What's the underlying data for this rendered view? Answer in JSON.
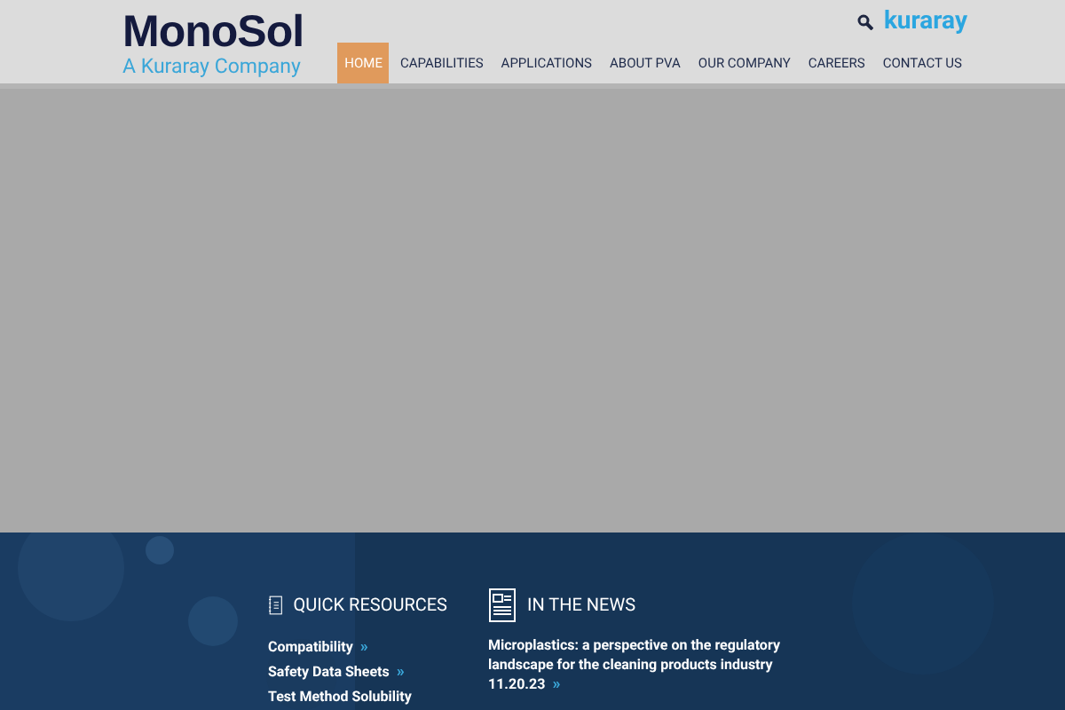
{
  "logo": {
    "name": "MonoSol",
    "tagline": "A Kuraray Company"
  },
  "brand": "kuraray",
  "nav": [
    {
      "label": "HOME",
      "selected": true
    },
    {
      "label": "CAPABILITIES",
      "selected": false
    },
    {
      "label": "APPLICATIONS",
      "selected": false
    },
    {
      "label": "ABOUT PVA",
      "selected": false
    },
    {
      "label": "OUR COMPANY",
      "selected": false
    },
    {
      "label": "CAREERS",
      "selected": false
    },
    {
      "label": "CONTACT US",
      "selected": false
    }
  ],
  "quick_resources": {
    "title": "QUICK RESOURCES",
    "links": [
      {
        "text": "Compatibility",
        "more": "»"
      },
      {
        "text": "Safety Data Sheets",
        "more": "»"
      },
      {
        "text": "Test Method Solubility"
      }
    ]
  },
  "news": {
    "title": "IN THE NEWS",
    "items": [
      {
        "headline": "Microplastics: a perspective on the regulatory landscape for the cleaning products industry",
        "date": "11.20.23",
        "more": "»"
      }
    ]
  }
}
